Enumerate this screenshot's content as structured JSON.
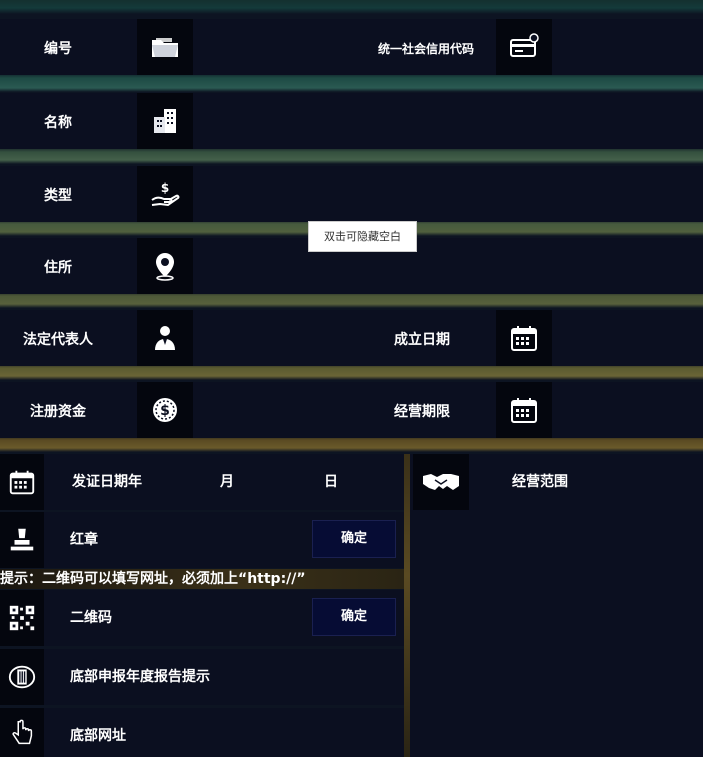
{
  "fields": {
    "number_label": "编号",
    "credit_code_label": "统一社会信用代码",
    "name_label": "名称",
    "type_label": "类型",
    "address_label": "住所",
    "legal_rep_label": "法定代表人",
    "founded_label": "成立日期",
    "capital_label": "注册资金",
    "term_label": "经营期限"
  },
  "tooltip": "双击可隐藏空白",
  "issue": {
    "label": "发证日期年",
    "month": "月",
    "day": "日"
  },
  "seal": {
    "label": "红章",
    "confirm": "确定"
  },
  "hint": "提示：二维码可以填写网址，必须加上“http://”",
  "qrcode": {
    "label": "二维码",
    "confirm": "确定"
  },
  "report_hint": "底部申报年度报告提示",
  "bottom_url": "底部网址",
  "scope_label": "经营范围",
  "colors": {
    "background": "#0d1422",
    "band": "#0b0f20",
    "icon_box": "#04060e",
    "button": "#060c34"
  },
  "icons": {
    "number": "folder-icon",
    "credit_code": "id-card-icon",
    "name": "building-icon",
    "type": "money-hand-icon",
    "address": "location-pin-icon",
    "legal_rep": "person-icon",
    "founded": "calendar-icon",
    "capital": "dollar-coin-icon",
    "term": "calendar-icon",
    "issue": "calendar-icon",
    "seal": "stamp-icon",
    "qrcode": "qrcode-icon",
    "report": "emblem-icon",
    "url": "hand-pointer-icon",
    "scope": "handshake-icon"
  }
}
